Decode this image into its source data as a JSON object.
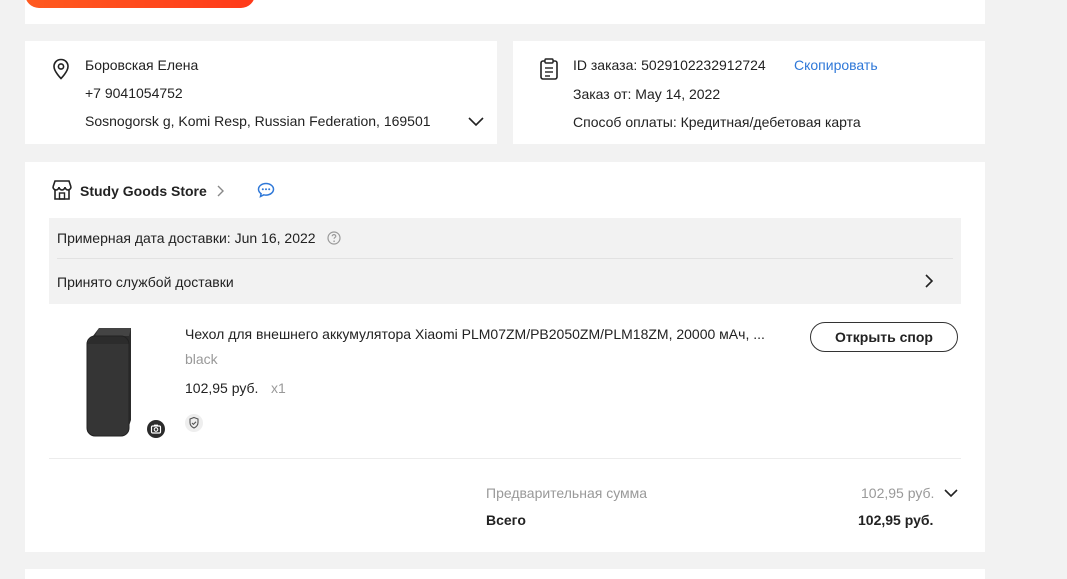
{
  "address": {
    "name": "Боровская Елена",
    "phone": "+7 9041054752",
    "address_line": "Sosnogorsk g, Komi Resp, Russian Federation, 169501"
  },
  "order": {
    "id_text": "ID заказа: 5029102232912724",
    "copy_label": "Скопировать",
    "date_text": "Заказ от: May 14, 2022",
    "payment_text": "Способ оплаты: Кредитная/дебетовая карта"
  },
  "store": {
    "name": "Study Goods Store"
  },
  "delivery": {
    "estimate_text": "Примерная дата доставки: Jun 16, 2022",
    "status_text": "Принято службой доставки"
  },
  "item": {
    "title": "Чехол для внешнего аккумулятора Xiaomi PLM07ZM/PB2050ZM/PLM18ZM, 20000 мАч, ...",
    "variant": "black",
    "price": "102,95 руб.",
    "quantity": "x1",
    "dispute_label": "Открыть спор",
    "image_color": "#3b3b3b"
  },
  "summary": {
    "subtotal_label": "Предварительная сумма",
    "subtotal_value": "102,95 руб.",
    "total_label": "Всего",
    "total_value": "102,95 руб."
  },
  "colors": {
    "accent_link": "#2f78d8",
    "brand_orange": "#ff4a1c"
  }
}
